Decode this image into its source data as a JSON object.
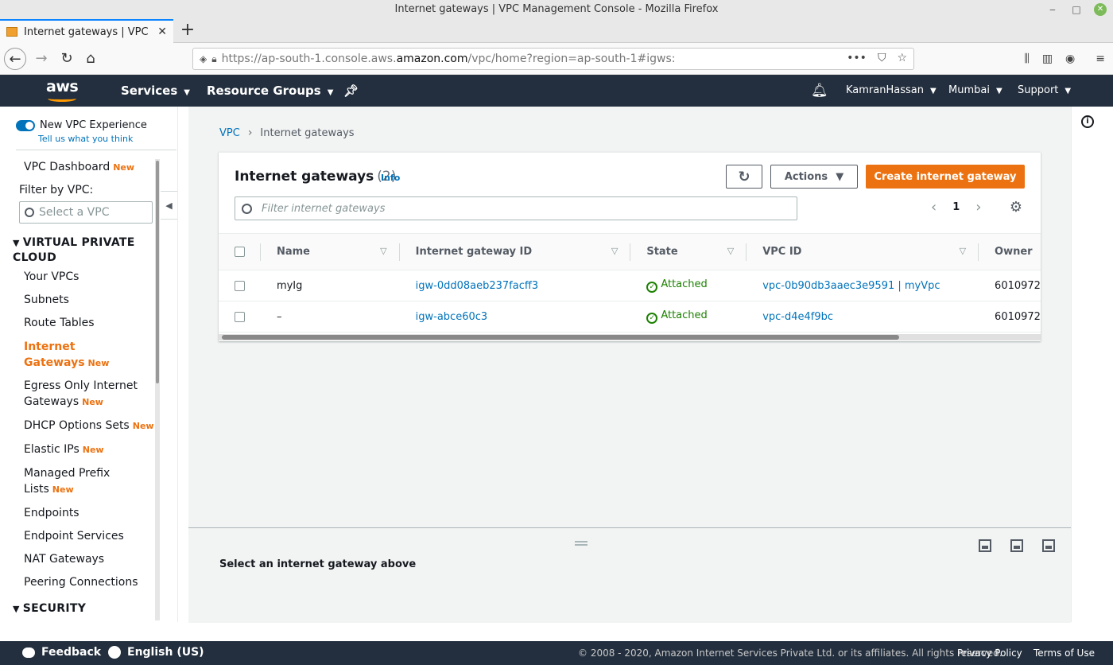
{
  "window": {
    "title": "Internet gateways | VPC Management Console - Mozilla Firefox"
  },
  "browser": {
    "tab_title": "Internet gateways | VPC Ma",
    "url_prefix": "https://ap-south-1.console.aws.",
    "url_domain": "amazon.com",
    "url_suffix": "/vpc/home?region=ap-south-1#igws:"
  },
  "aws_header": {
    "logo_text": "aws",
    "services": "Services",
    "resource_groups": "Resource Groups",
    "user": "KamranHassan",
    "region": "Mumbai",
    "support": "Support"
  },
  "sidebar": {
    "toggle_label": "New VPC Experience",
    "tell_link": "Tell us what you think",
    "dashboard": "VPC Dashboard",
    "new_badge": "New",
    "filter_label": "Filter by VPC:",
    "filter_placeholder": "Select a VPC",
    "section_vpc": "VIRTUAL PRIVATE CLOUD",
    "items": {
      "your_vpcs": "Your VPCs",
      "subnets": "Subnets",
      "route_tables": "Route Tables",
      "internet_gateways": "Internet Gateways",
      "egress_only": "Egress Only Internet Gateways",
      "dhcp": "DHCP Options Sets",
      "elastic_ips": "Elastic IPs",
      "prefix_lists": "Managed Prefix Lists",
      "endpoints": "Endpoints",
      "endpoint_services": "Endpoint Services",
      "nat_gateways": "NAT Gateways",
      "peering": "Peering Connections"
    },
    "section_security": "SECURITY"
  },
  "breadcrumb": {
    "root": "VPC",
    "current": "Internet gateways"
  },
  "panel": {
    "title": "Internet gateways",
    "count": "(2)",
    "info": "Info",
    "actions": "Actions",
    "create": "Create internet gateway",
    "search_placeholder": "Filter internet gateways",
    "page": "1"
  },
  "table": {
    "headers": {
      "name": "Name",
      "igw_id": "Internet gateway ID",
      "state": "State",
      "vpc_id": "VPC ID",
      "owner": "Owner"
    },
    "rows": [
      {
        "name": "myIg",
        "igw_id": "igw-0dd08aeb237facff3",
        "state": "Attached",
        "vpc_id": "vpc-0b90db3aaec3e9591 | myVpc",
        "owner": "6010972"
      },
      {
        "name": "–",
        "igw_id": "igw-abce60c3",
        "state": "Attached",
        "vpc_id": "vpc-d4e4f9bc",
        "owner": "6010972"
      }
    ]
  },
  "split_panel": {
    "message": "Select an internet gateway above"
  },
  "footer": {
    "feedback": "Feedback",
    "language": "English (US)",
    "copyright": "© 2008 - 2020, Amazon Internet Services Private Ltd. or its affiliates. All rights reserved.",
    "privacy": "Privacy Policy",
    "terms": "Terms of Use"
  },
  "colors": {
    "aws_nav": "#232f3e",
    "accent_orange": "#ec7211",
    "link_blue": "#0073bb",
    "success_green": "#1d8102"
  }
}
